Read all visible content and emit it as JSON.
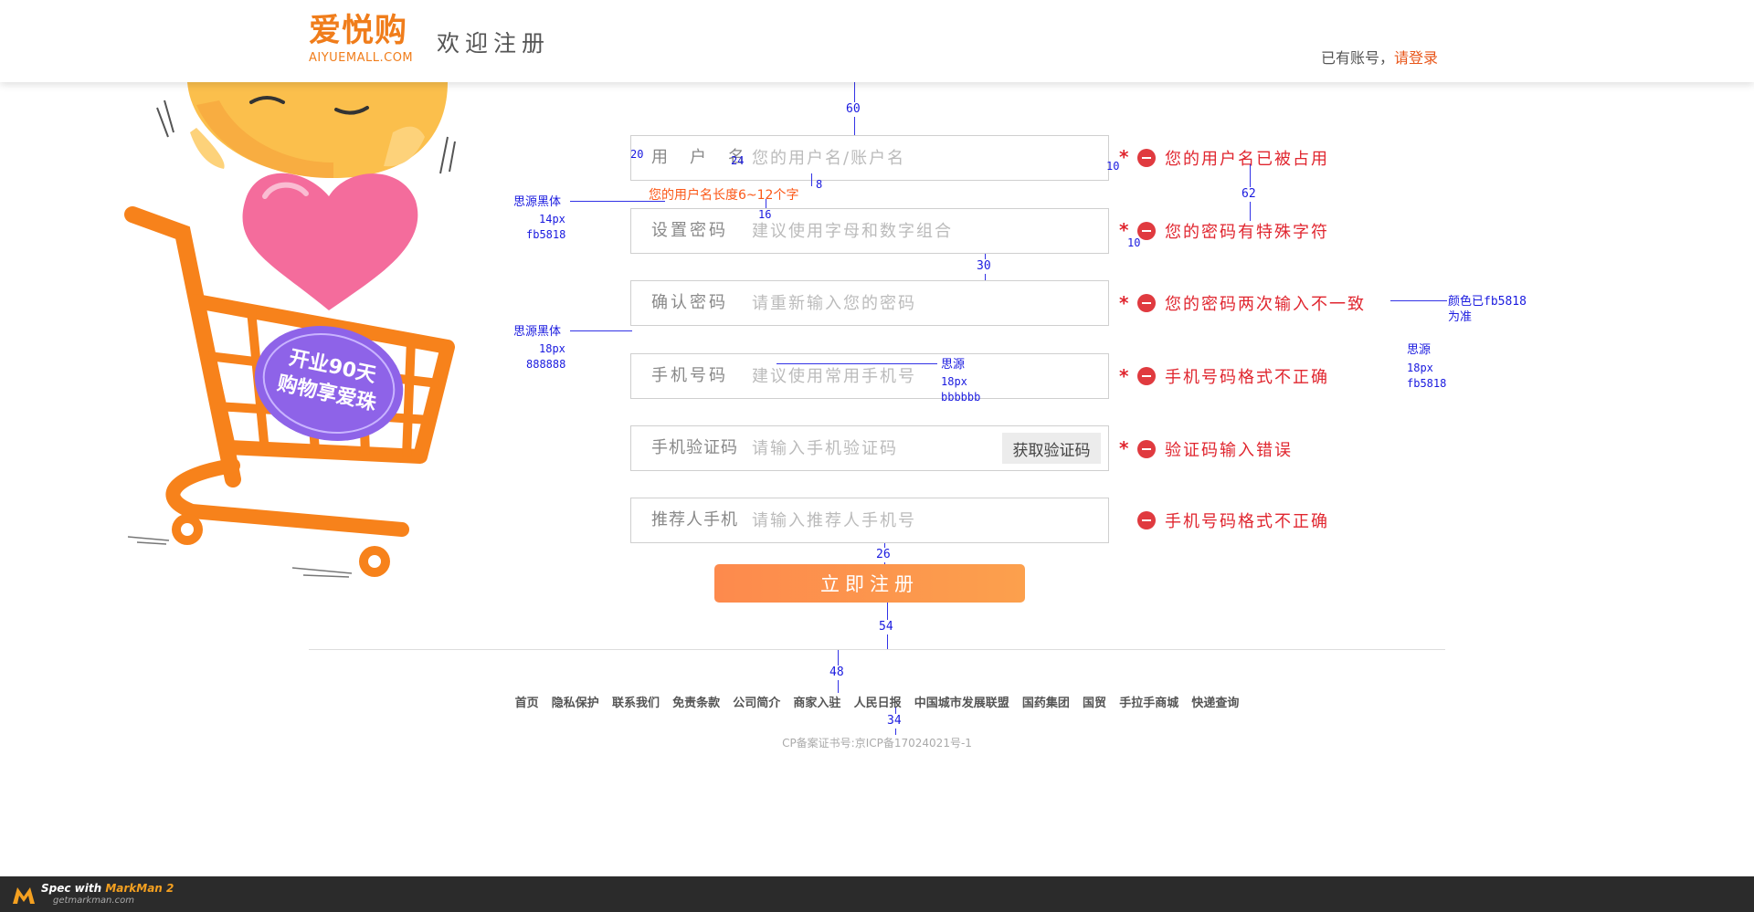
{
  "header": {
    "logo_cn": "爱悦购",
    "logo_en": "AIYUEMALL.COM",
    "title": "欢迎注册",
    "login_prefix": "已有账号，",
    "login_link": "请登录"
  },
  "illustration": {
    "badge_line1": "开业90天",
    "badge_line2": "购物享爱珠"
  },
  "form": {
    "fields": [
      {
        "label": "用　户　名",
        "placeholder": "您的用户名/账户名",
        "required": true,
        "error": "您的用户名已被占用"
      },
      {
        "label": "设置密码",
        "placeholder": "建议使用字母和数字组合",
        "required": true,
        "error": "您的密码有特殊字符"
      },
      {
        "label": "确认密码",
        "placeholder": "请重新输入您的密码",
        "required": true,
        "error": "您的密码两次输入不一致"
      },
      {
        "label": "手机号码",
        "placeholder": "建议使用常用手机号",
        "required": true,
        "error": "手机号码格式不正确"
      },
      {
        "label": "手机验证码",
        "placeholder": "请输入手机验证码",
        "required": true,
        "error": "验证码输入错误",
        "button": "获取验证码"
      },
      {
        "label": "推荐人手机",
        "placeholder": "请输入推荐人手机号",
        "required": false,
        "error": "手机号码格式不正确"
      }
    ],
    "username_hint": "您的用户名长度6~12个字",
    "submit_label": "立即注册"
  },
  "footer": {
    "links": [
      "首页",
      "隐私保护",
      "联系我们",
      "免责条款",
      "公司简介",
      "商家入驻",
      "人民日报",
      "中国城市发展联盟",
      "国药集团",
      "国贸",
      "手拉手商城",
      "快递查询"
    ],
    "copyright": "CP备案证书号:京ICP备17024021号-1"
  },
  "annotations": {
    "spacing": [
      "60",
      "20",
      "24",
      "8",
      "16",
      "10",
      "10",
      "62",
      "30",
      "26",
      "54",
      "48",
      "34"
    ],
    "note_hint": [
      "思源黑体",
      "14px",
      "fb5818"
    ],
    "note_label": [
      "思源黑体",
      "18px",
      "888888"
    ],
    "note_placeholder": [
      "思源",
      "18px",
      "bbbbbb"
    ],
    "note_error_color": [
      "颜色已fb5818",
      "为准"
    ],
    "note_error_font": [
      "思源",
      "18px",
      "fb5818"
    ]
  },
  "markman": {
    "line1_prefix": "Spec with ",
    "line1_brand": "MarkMan 2",
    "line2": "getmarkman.com"
  },
  "colors": {
    "brand_orange": "#f07d1b",
    "error_red": "#fb5818",
    "label_gray": "#888888",
    "placeholder_gray": "#bbbbbb",
    "annotation_blue": "#1a1adf"
  }
}
